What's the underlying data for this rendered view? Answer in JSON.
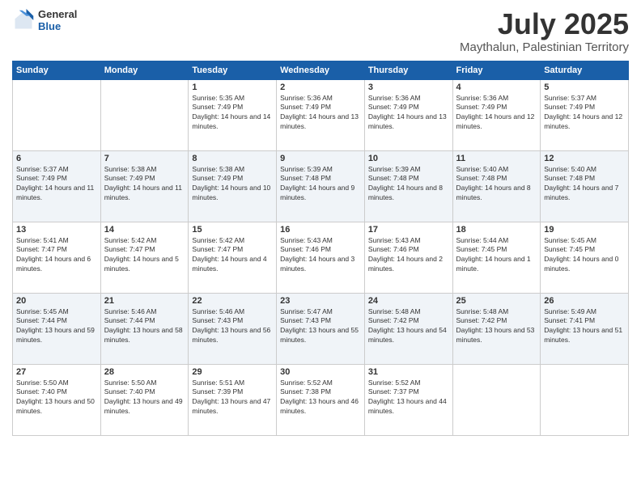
{
  "logo": {
    "general": "General",
    "blue": "Blue"
  },
  "header": {
    "month": "July 2025",
    "location": "Maythalun, Palestinian Territory"
  },
  "weekdays": [
    "Sunday",
    "Monday",
    "Tuesday",
    "Wednesday",
    "Thursday",
    "Friday",
    "Saturday"
  ],
  "weeks": [
    [
      {
        "day": "",
        "sunrise": "",
        "sunset": "",
        "daylight": ""
      },
      {
        "day": "",
        "sunrise": "",
        "sunset": "",
        "daylight": ""
      },
      {
        "day": "1",
        "sunrise": "Sunrise: 5:35 AM",
        "sunset": "Sunset: 7:49 PM",
        "daylight": "Daylight: 14 hours and 14 minutes."
      },
      {
        "day": "2",
        "sunrise": "Sunrise: 5:36 AM",
        "sunset": "Sunset: 7:49 PM",
        "daylight": "Daylight: 14 hours and 13 minutes."
      },
      {
        "day": "3",
        "sunrise": "Sunrise: 5:36 AM",
        "sunset": "Sunset: 7:49 PM",
        "daylight": "Daylight: 14 hours and 13 minutes."
      },
      {
        "day": "4",
        "sunrise": "Sunrise: 5:36 AM",
        "sunset": "Sunset: 7:49 PM",
        "daylight": "Daylight: 14 hours and 12 minutes."
      },
      {
        "day": "5",
        "sunrise": "Sunrise: 5:37 AM",
        "sunset": "Sunset: 7:49 PM",
        "daylight": "Daylight: 14 hours and 12 minutes."
      }
    ],
    [
      {
        "day": "6",
        "sunrise": "Sunrise: 5:37 AM",
        "sunset": "Sunset: 7:49 PM",
        "daylight": "Daylight: 14 hours and 11 minutes."
      },
      {
        "day": "7",
        "sunrise": "Sunrise: 5:38 AM",
        "sunset": "Sunset: 7:49 PM",
        "daylight": "Daylight: 14 hours and 11 minutes."
      },
      {
        "day": "8",
        "sunrise": "Sunrise: 5:38 AM",
        "sunset": "Sunset: 7:49 PM",
        "daylight": "Daylight: 14 hours and 10 minutes."
      },
      {
        "day": "9",
        "sunrise": "Sunrise: 5:39 AM",
        "sunset": "Sunset: 7:48 PM",
        "daylight": "Daylight: 14 hours and 9 minutes."
      },
      {
        "day": "10",
        "sunrise": "Sunrise: 5:39 AM",
        "sunset": "Sunset: 7:48 PM",
        "daylight": "Daylight: 14 hours and 8 minutes."
      },
      {
        "day": "11",
        "sunrise": "Sunrise: 5:40 AM",
        "sunset": "Sunset: 7:48 PM",
        "daylight": "Daylight: 14 hours and 8 minutes."
      },
      {
        "day": "12",
        "sunrise": "Sunrise: 5:40 AM",
        "sunset": "Sunset: 7:48 PM",
        "daylight": "Daylight: 14 hours and 7 minutes."
      }
    ],
    [
      {
        "day": "13",
        "sunrise": "Sunrise: 5:41 AM",
        "sunset": "Sunset: 7:47 PM",
        "daylight": "Daylight: 14 hours and 6 minutes."
      },
      {
        "day": "14",
        "sunrise": "Sunrise: 5:42 AM",
        "sunset": "Sunset: 7:47 PM",
        "daylight": "Daylight: 14 hours and 5 minutes."
      },
      {
        "day": "15",
        "sunrise": "Sunrise: 5:42 AM",
        "sunset": "Sunset: 7:47 PM",
        "daylight": "Daylight: 14 hours and 4 minutes."
      },
      {
        "day": "16",
        "sunrise": "Sunrise: 5:43 AM",
        "sunset": "Sunset: 7:46 PM",
        "daylight": "Daylight: 14 hours and 3 minutes."
      },
      {
        "day": "17",
        "sunrise": "Sunrise: 5:43 AM",
        "sunset": "Sunset: 7:46 PM",
        "daylight": "Daylight: 14 hours and 2 minutes."
      },
      {
        "day": "18",
        "sunrise": "Sunrise: 5:44 AM",
        "sunset": "Sunset: 7:45 PM",
        "daylight": "Daylight: 14 hours and 1 minute."
      },
      {
        "day": "19",
        "sunrise": "Sunrise: 5:45 AM",
        "sunset": "Sunset: 7:45 PM",
        "daylight": "Daylight: 14 hours and 0 minutes."
      }
    ],
    [
      {
        "day": "20",
        "sunrise": "Sunrise: 5:45 AM",
        "sunset": "Sunset: 7:44 PM",
        "daylight": "Daylight: 13 hours and 59 minutes."
      },
      {
        "day": "21",
        "sunrise": "Sunrise: 5:46 AM",
        "sunset": "Sunset: 7:44 PM",
        "daylight": "Daylight: 13 hours and 58 minutes."
      },
      {
        "day": "22",
        "sunrise": "Sunrise: 5:46 AM",
        "sunset": "Sunset: 7:43 PM",
        "daylight": "Daylight: 13 hours and 56 minutes."
      },
      {
        "day": "23",
        "sunrise": "Sunrise: 5:47 AM",
        "sunset": "Sunset: 7:43 PM",
        "daylight": "Daylight: 13 hours and 55 minutes."
      },
      {
        "day": "24",
        "sunrise": "Sunrise: 5:48 AM",
        "sunset": "Sunset: 7:42 PM",
        "daylight": "Daylight: 13 hours and 54 minutes."
      },
      {
        "day": "25",
        "sunrise": "Sunrise: 5:48 AM",
        "sunset": "Sunset: 7:42 PM",
        "daylight": "Daylight: 13 hours and 53 minutes."
      },
      {
        "day": "26",
        "sunrise": "Sunrise: 5:49 AM",
        "sunset": "Sunset: 7:41 PM",
        "daylight": "Daylight: 13 hours and 51 minutes."
      }
    ],
    [
      {
        "day": "27",
        "sunrise": "Sunrise: 5:50 AM",
        "sunset": "Sunset: 7:40 PM",
        "daylight": "Daylight: 13 hours and 50 minutes."
      },
      {
        "day": "28",
        "sunrise": "Sunrise: 5:50 AM",
        "sunset": "Sunset: 7:40 PM",
        "daylight": "Daylight: 13 hours and 49 minutes."
      },
      {
        "day": "29",
        "sunrise": "Sunrise: 5:51 AM",
        "sunset": "Sunset: 7:39 PM",
        "daylight": "Daylight: 13 hours and 47 minutes."
      },
      {
        "day": "30",
        "sunrise": "Sunrise: 5:52 AM",
        "sunset": "Sunset: 7:38 PM",
        "daylight": "Daylight: 13 hours and 46 minutes."
      },
      {
        "day": "31",
        "sunrise": "Sunrise: 5:52 AM",
        "sunset": "Sunset: 7:37 PM",
        "daylight": "Daylight: 13 hours and 44 minutes."
      },
      {
        "day": "",
        "sunrise": "",
        "sunset": "",
        "daylight": ""
      },
      {
        "day": "",
        "sunrise": "",
        "sunset": "",
        "daylight": ""
      }
    ]
  ]
}
